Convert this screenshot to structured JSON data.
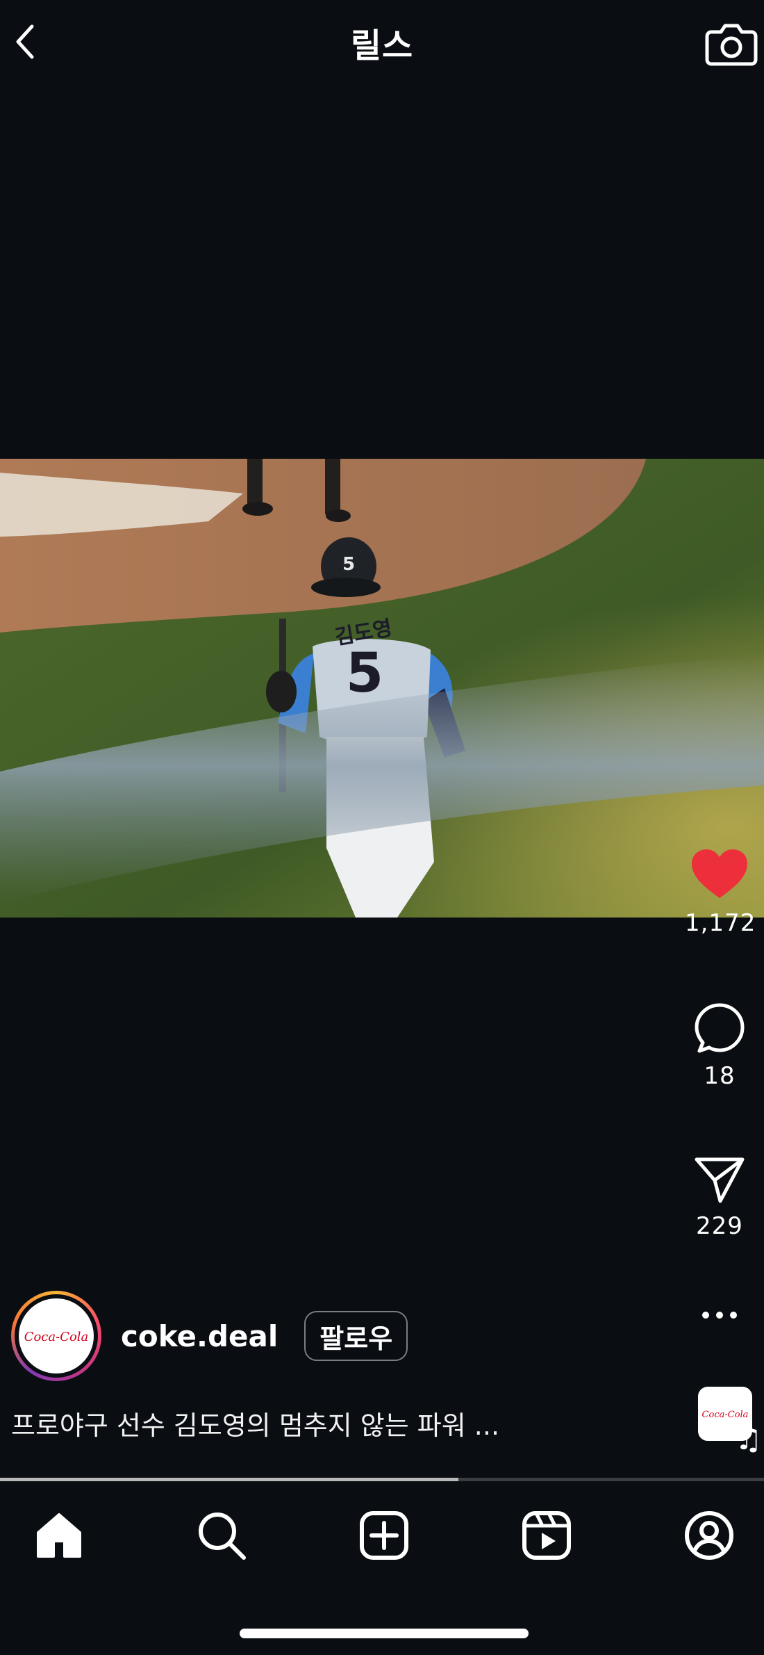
{
  "header": {
    "title": "릴스"
  },
  "post": {
    "username": "coke.deal",
    "follow_label": "팔로우",
    "caption": "프로야구 선수 김도영의 멈추지 않는 파워 ...",
    "avatar_text": "Coca-Cola",
    "audio_thumb_text": "Coca-Cola",
    "video": {
      "jersey_name": "김도영",
      "jersey_number": "5",
      "helmet_number": "5"
    }
  },
  "actions": {
    "likes": "1,172",
    "comments": "18",
    "shares": "229",
    "liked": true,
    "like_color": "#ed2f3c"
  },
  "playback": {
    "progress": 0.6
  },
  "tabs": [
    {
      "name": "home",
      "icon": "home-icon",
      "active": true
    },
    {
      "name": "search",
      "icon": "search-icon"
    },
    {
      "name": "create",
      "icon": "plus-square-icon"
    },
    {
      "name": "reels",
      "icon": "reels-icon"
    },
    {
      "name": "profile",
      "icon": "profile-icon"
    }
  ],
  "colors": {
    "background": "#0a0d11",
    "like": "#ed2f3c",
    "brand_red": "#d6001c"
  }
}
